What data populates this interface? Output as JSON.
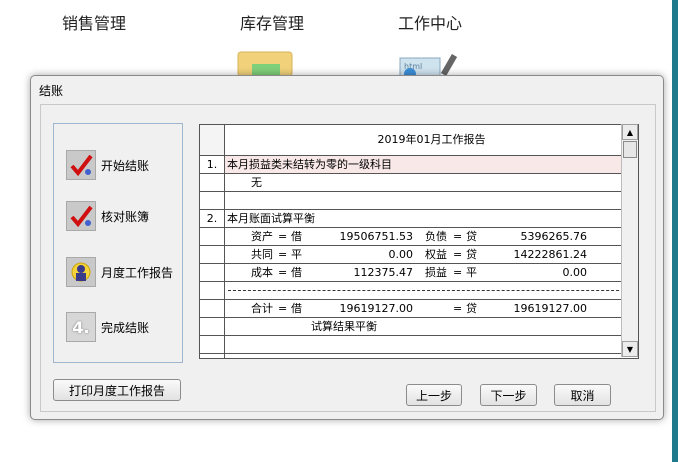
{
  "background": {
    "labels": [
      "销售管理",
      "库存管理",
      "工作中心"
    ]
  },
  "dialog": {
    "title": "结账",
    "steps": [
      {
        "label": "开始结账",
        "icon": "check-icon"
      },
      {
        "label": "核对账簿",
        "icon": "check-icon"
      },
      {
        "label": "月度工作报告",
        "icon": "report-person-icon"
      },
      {
        "label": "完成结账",
        "icon": "number-4-icon",
        "glyph": "4."
      }
    ],
    "report": {
      "title": "2019年01月工作报告",
      "section1_num": "1.",
      "section1_text": "本月损益类未结转为零的一级科目",
      "section1_value": "无",
      "section2_num": "2.",
      "section2_text": "本月账面试算平衡",
      "rows": [
        {
          "a_label": "资产",
          "a_eq": "=",
          "a_dir": "借",
          "a_val": "19506751.53",
          "b_label": "负债",
          "b_eq": "=",
          "b_dir": "贷",
          "b_val": "5396265.76"
        },
        {
          "a_label": "共同",
          "a_eq": "=",
          "a_dir": "平",
          "a_val": "0.00",
          "b_label": "权益",
          "b_eq": "=",
          "b_dir": "贷",
          "b_val": "14222861.24"
        },
        {
          "a_label": "成本",
          "a_eq": "=",
          "a_dir": "借",
          "a_val": "112375.47",
          "b_label": "损益",
          "b_eq": "=",
          "b_dir": "平",
          "b_val": "0.00"
        }
      ],
      "total": {
        "a_label": "合计",
        "a_eq": "=",
        "a_dir": "借",
        "a_val": "19619127.00",
        "b_eq": "=",
        "b_dir": "贷",
        "b_val": "19619127.00"
      },
      "result": "试算结果平衡"
    },
    "buttons": {
      "print": "打印月度工作报告",
      "prev": "上一步",
      "next": "下一步",
      "cancel": "取消"
    }
  }
}
